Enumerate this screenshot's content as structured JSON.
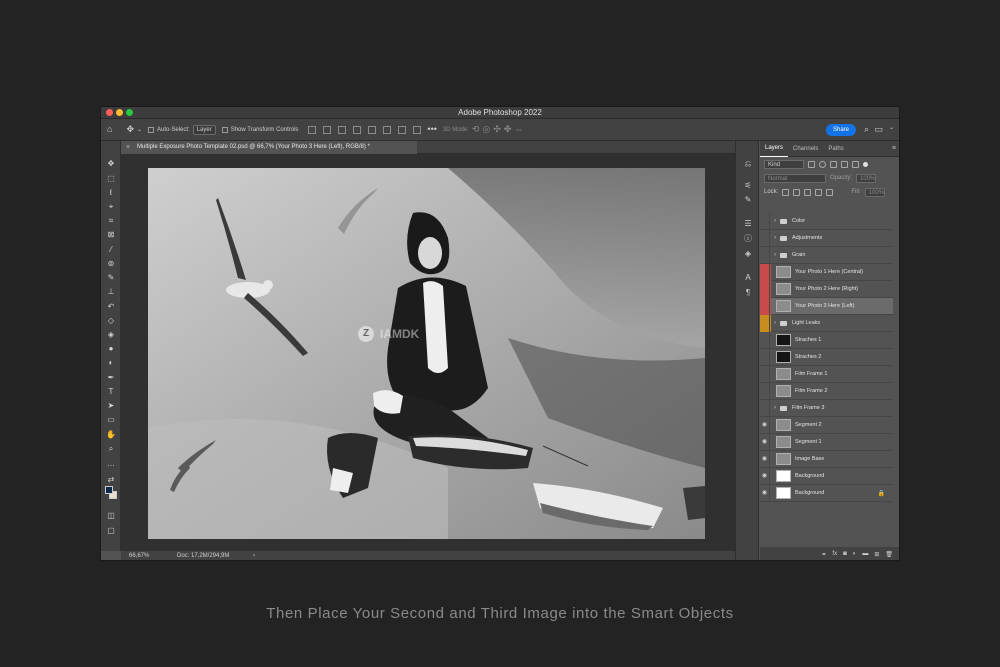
{
  "window": {
    "title": "Adobe Photoshop 2022",
    "traffic_colors": [
      "#ff5f57",
      "#febc2e",
      "#28c840"
    ]
  },
  "options_bar": {
    "auto_select_label": "Auto-Select:",
    "auto_select_value": "Layer",
    "show_transform_label": "Show Transform Controls",
    "mode_label": "3D Mode:",
    "share_label": "Share"
  },
  "document": {
    "tab_title": "Multiple Exposure Photo Template 02.psd @ 66,7% (Your Photo 3 Here (Left), RGB/8) *"
  },
  "status_bar": {
    "zoom": "66,67%",
    "doc_info": "Doc: 17,2M/294,9M"
  },
  "canvas": {
    "watermark_text": "IAMDK"
  },
  "layers_panel": {
    "tabs": [
      "Layers",
      "Channels",
      "Paths"
    ],
    "filter_kind": "Kind",
    "blend_mode": "Normal",
    "opacity_label": "Opacity:",
    "opacity_value": "100%",
    "lock_label": "Lock:",
    "fill_label": "Fill:",
    "fill_value": "100%",
    "layers": [
      {
        "name": "Color",
        "type": "group",
        "visible": false,
        "tag": ""
      },
      {
        "name": "Adjustments",
        "type": "group",
        "visible": false,
        "tag": ""
      },
      {
        "name": "Grain",
        "type": "group",
        "visible": false,
        "tag": ""
      },
      {
        "name": "Your Photo 1 Here (Central)",
        "type": "smart",
        "visible": false,
        "tag": "red"
      },
      {
        "name": "Your Photo 2 Here (Right)",
        "type": "smart",
        "visible": false,
        "tag": "red"
      },
      {
        "name": "Your Photo 3 Here (Left)",
        "type": "smart",
        "visible": false,
        "tag": "red",
        "selected": true
      },
      {
        "name": "Light Leaks",
        "type": "group",
        "visible": false,
        "tag": "orange"
      },
      {
        "name": "Straches 1",
        "type": "layer-dark",
        "visible": false,
        "tag": ""
      },
      {
        "name": "Straches 2",
        "type": "layer-dark",
        "visible": false,
        "tag": ""
      },
      {
        "name": "Film Frame 1",
        "type": "layer",
        "visible": false,
        "tag": ""
      },
      {
        "name": "Film Frame 2",
        "type": "layer",
        "visible": false,
        "tag": ""
      },
      {
        "name": "Film Frame 3",
        "type": "group",
        "visible": false,
        "tag": ""
      },
      {
        "name": "Segment 2",
        "type": "smart",
        "visible": true,
        "tag": ""
      },
      {
        "name": "Segment 1",
        "type": "smart",
        "visible": true,
        "tag": ""
      },
      {
        "name": "Image Base",
        "type": "smart",
        "visible": true,
        "tag": ""
      },
      {
        "name": "Background",
        "type": "layer-white",
        "visible": true,
        "tag": ""
      },
      {
        "name": "Background",
        "type": "layer-white",
        "visible": true,
        "tag": "",
        "locked": true
      }
    ],
    "tag_colors": {
      "red": "#c94a4a",
      "orange": "#c88b1e"
    }
  },
  "caption": "Then Place Your Second and Third Image into the Smart Objects"
}
